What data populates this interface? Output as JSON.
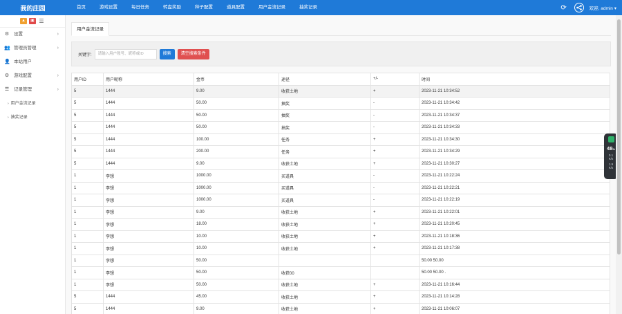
{
  "brand": "我的庄园",
  "nav": [
    "首页",
    "游戏设置",
    "每日任务",
    "转盘奖励",
    "种子配置",
    "道具配置",
    "用户金流记录",
    "抽奖记录"
  ],
  "user": "欢迎, admin ▾",
  "sidebar": {
    "quick": [
      "▲",
      "▣",
      "☰"
    ],
    "items": [
      {
        "label": "设置",
        "icon": "⚙",
        "arrow": "›"
      },
      {
        "label": "管理员管理",
        "icon": "👥",
        "arrow": "›"
      },
      {
        "label": "本站用户",
        "icon": "👤",
        "arrow": ""
      },
      {
        "label": "游戏配置",
        "icon": "⚙",
        "arrow": "›"
      },
      {
        "label": "记录管理",
        "icon": "☰",
        "arrow": "›"
      }
    ],
    "sub": [
      "用户金流记录",
      "抽奖记录"
    ]
  },
  "tab": "用户金流记录",
  "search": {
    "label": "关键字:",
    "placeholder": "请输入用户账号、昵称或ID",
    "search_btn": "搜索",
    "clear_btn": "清空搜索条件"
  },
  "table": {
    "headers": [
      "用户ID",
      "用户昵称",
      "金币",
      "途径",
      "+/-",
      "时间"
    ],
    "rows": [
      [
        "5",
        "1444",
        "9.00",
        "收获土地",
        "+",
        "2023-11-21 10:34:52"
      ],
      [
        "5",
        "1444",
        "50.00",
        "抽奖",
        "-",
        "2023-11-21 10:34:42"
      ],
      [
        "5",
        "1444",
        "50.00",
        "抽奖",
        "-",
        "2023-11-21 10:34:37"
      ],
      [
        "5",
        "1444",
        "50.00",
        "抽奖",
        "-",
        "2023-11-21 10:34:33"
      ],
      [
        "5",
        "1444",
        "100.00",
        "任务",
        "+",
        "2023-11-21 10:34:30"
      ],
      [
        "5",
        "1444",
        "200.00",
        "任务",
        "+",
        "2023-11-21 10:34:29"
      ],
      [
        "5",
        "1444",
        "9.00",
        "收获土地",
        "+",
        "2023-11-21 10:30:27"
      ],
      [
        "1",
        "李想",
        "1000.00",
        "买道具",
        "-",
        "2023-11-21 10:22:24"
      ],
      [
        "1",
        "李想",
        "1000.00",
        "买道具",
        "-",
        "2023-11-21 10:22:21"
      ],
      [
        "1",
        "李想",
        "1000.00",
        "买道具",
        "-",
        "2023-11-21 10:22:19"
      ],
      [
        "1",
        "李想",
        "9.00",
        "收获土地",
        "+",
        "2023-11-21 10:22:01"
      ],
      [
        "1",
        "李想",
        "18.00",
        "收获土地",
        "+",
        "2023-11-21 10:20:45"
      ],
      [
        "1",
        "李想",
        "10.00",
        "收获土地",
        "+",
        "2023-11-21 10:18:36"
      ],
      [
        "1",
        "李想",
        "10.00",
        "收获土地",
        "+",
        "2023-11-21 10:17:38"
      ],
      [
        "1",
        "李想",
        "50.00",
        "",
        "",
        "50.00        50.00"
      ],
      [
        "1",
        "李想",
        "50.00",
        "收获00",
        "",
        "50.00   50.00 ."
      ],
      [
        "1",
        "李想",
        "50.00",
        "收获土地",
        "+",
        "2023-11-21 10:16:44"
      ],
      [
        "5",
        "1444",
        "45.00",
        "收获土地",
        "+",
        "2023-11-21 10:14:28"
      ],
      [
        "5",
        "1444",
        "9.00",
        "收获土地",
        "+",
        "2023-11-21 10:06:07"
      ]
    ]
  },
  "widget": {
    "value": "48",
    "unit": "%",
    "up": "0.1",
    "down": "1.9",
    "rate_unit": "K/s"
  }
}
